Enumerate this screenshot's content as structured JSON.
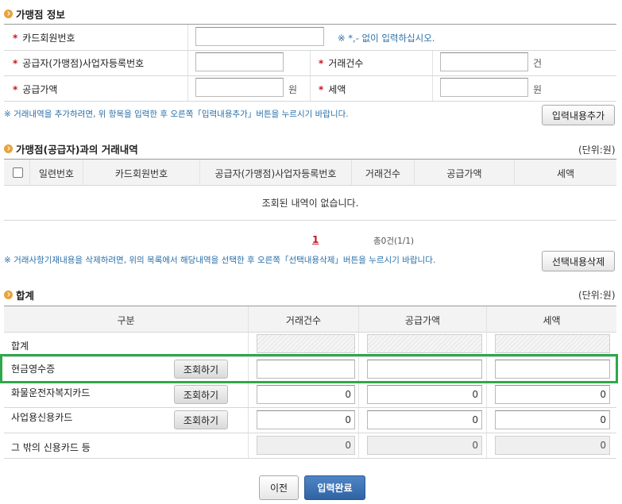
{
  "merchant_info": {
    "title": "가맹점 정보",
    "card_member_no_label": "카드회원번호",
    "card_member_no_value": "",
    "card_hint": "※ *,- 없이 입력하십시오.",
    "biz_reg_no_label": "공급자(가맹점)사업자등록번호",
    "biz_reg_no_value": "",
    "tx_count_label": "거래건수",
    "tx_count_value": "",
    "tx_count_unit": "건",
    "supply_amount_label": "공급가액",
    "supply_amount_value": "",
    "supply_amount_unit": "원",
    "tax_label": "세액",
    "tax_value": "",
    "tax_unit": "원",
    "add_note": "※ 거래내역을 추가하려면, 위 항목을 입력한 후 오른쪽「입력내용추가」버튼을 누르시기 바랍니다.",
    "add_button": "입력내용추가"
  },
  "transactions": {
    "title": "가맹점(공급자)과의 거래내역",
    "unit": "(단위:원)",
    "columns": [
      "일련번호",
      "카드회원번호",
      "공급자(가맹점)사업자등록번호",
      "거래건수",
      "공급가액",
      "세액"
    ],
    "empty_message": "조회된 내역이 없습니다.",
    "page": "1",
    "total": "총0건(1/1)",
    "delete_note": "※ 거래사항기재내용을 삭제하려면, 위의 목록에서 해당내역을 선택한 후 오른쪽「선택내용삭제」버튼을 누르시기 바랍니다.",
    "delete_button": "선택내용삭제"
  },
  "summary": {
    "title": "합계",
    "unit": "(단위:원)",
    "columns": [
      "구분",
      "거래건수",
      "공급가액",
      "세액"
    ],
    "rows": [
      {
        "label": "합계",
        "button": "",
        "count": "",
        "supply": "",
        "tax": ""
      },
      {
        "label": "현금영수증",
        "button": "조회하기",
        "count": "",
        "supply": "",
        "tax": ""
      },
      {
        "label": "화물운전자복지카드",
        "button": "조회하기",
        "count": "0",
        "supply": "0",
        "tax": "0"
      },
      {
        "label": "사업용신용카드",
        "button": "조회하기",
        "count": "0",
        "supply": "0",
        "tax": "0"
      },
      {
        "label": "그 밖의 신용카드 등",
        "button": "",
        "count": "0",
        "supply": "0",
        "tax": "0"
      }
    ]
  },
  "footer": {
    "prev_button": "이전",
    "submit_button": "입력완료"
  },
  "colors": {
    "accent_bullet": "#e8a33a",
    "required": "#c6181e",
    "note_text": "#2a6fa8",
    "highlight": "#2ea84a",
    "primary_button": "#3b6fb0"
  }
}
